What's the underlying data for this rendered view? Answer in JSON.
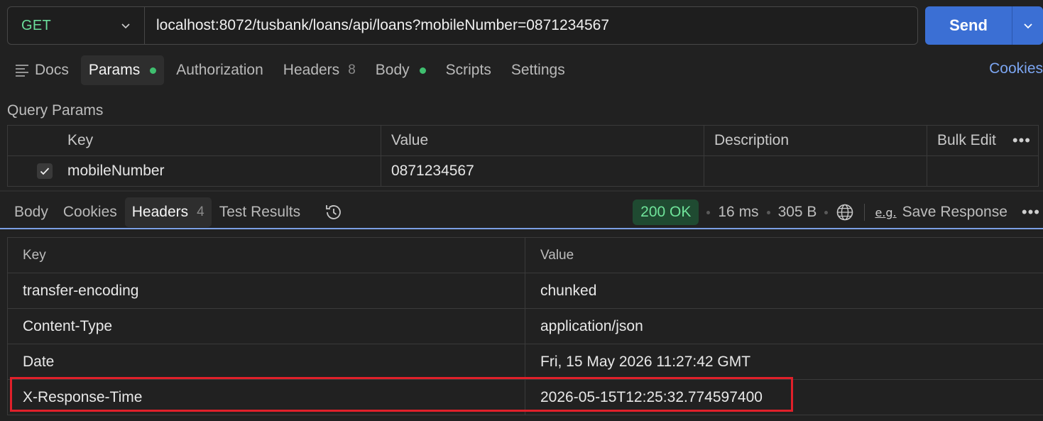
{
  "request": {
    "method": "GET",
    "url": "localhost:8072/tusbank/loans/api/loans?mobileNumber=0871234567",
    "send_label": "Send"
  },
  "request_tabs": [
    {
      "label": "Docs"
    },
    {
      "label": "Params",
      "dot": true
    },
    {
      "label": "Authorization"
    },
    {
      "label": "Headers",
      "count": "8"
    },
    {
      "label": "Body",
      "dot": true
    },
    {
      "label": "Scripts"
    },
    {
      "label": "Settings"
    }
  ],
  "cookies_link": "Cookies",
  "query_params": {
    "title": "Query Params",
    "headers": {
      "key": "Key",
      "value": "Value",
      "description": "Description",
      "bulk_edit": "Bulk Edit"
    },
    "rows": [
      {
        "checked": true,
        "key": "mobileNumber",
        "value": "0871234567",
        "description": ""
      }
    ]
  },
  "response_tabs": [
    {
      "label": "Body"
    },
    {
      "label": "Cookies"
    },
    {
      "label": "Headers",
      "count": "4"
    },
    {
      "label": "Test Results"
    }
  ],
  "response_meta": {
    "status": "200 OK",
    "time": "16 ms",
    "size": "305 B",
    "save_response": "Save Response",
    "save_icon_text": "e.g."
  },
  "response_headers": {
    "columns": {
      "key": "Key",
      "value": "Value"
    },
    "rows": [
      {
        "key": "transfer-encoding",
        "value": "chunked"
      },
      {
        "key": "Content-Type",
        "value": "application/json"
      },
      {
        "key": "Date",
        "value": "Fri, 15 May 2026 11:27:42 GMT"
      },
      {
        "key": "X-Response-Time",
        "value": "2026-05-15T12:25:32.774597400"
      }
    ]
  },
  "colors": {
    "method": "#6bdd9a",
    "send": "#3b6fd4",
    "status_bg": "#1f4a31",
    "status_text": "#6fe39a",
    "highlight": "#e0202a",
    "link": "#7ca6f2"
  }
}
